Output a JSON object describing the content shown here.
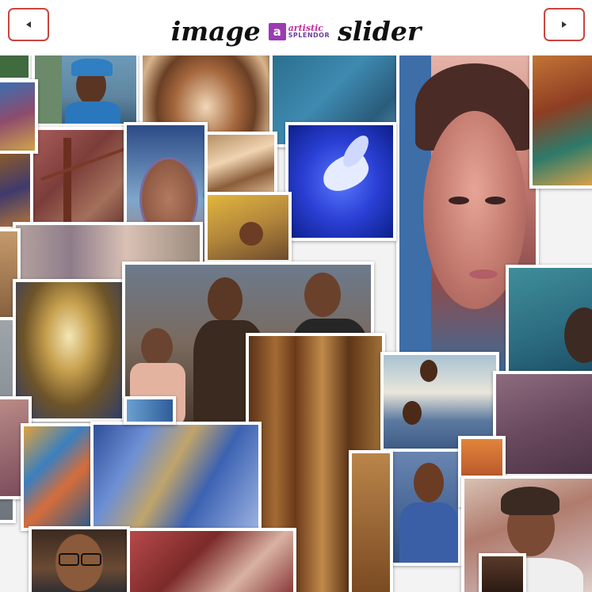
{
  "header": {
    "title_left": "image",
    "title_right": "slider",
    "logo_mark": "a",
    "logo_word_top": "artistic",
    "logo_word_bottom": "SPLENDOR",
    "prev_icon": "left-triangle-icon",
    "next_icon": "right-triangle-icon",
    "button_border_color": "#c8463f"
  },
  "gallery": {
    "tiles": [
      {
        "name": "painting-green-corner"
      },
      {
        "name": "painting-woman-blue-headwrap"
      },
      {
        "name": "painting-swirl-abstract"
      },
      {
        "name": "painting-blue-figure"
      },
      {
        "name": "painting-woman-closeup"
      },
      {
        "name": "painting-tree-abstract"
      },
      {
        "name": "painting-brown-tree"
      },
      {
        "name": "painting-woman-oval"
      },
      {
        "name": "painting-wood-swirl"
      },
      {
        "name": "painting-white-dove"
      },
      {
        "name": "painting-mask-yellow"
      },
      {
        "name": "painting-family-portrait"
      },
      {
        "name": "painting-wooden-carving"
      },
      {
        "name": "painting-couple-landscape"
      },
      {
        "name": "painting-woman-teal"
      },
      {
        "name": "painting-abstract-blue-geometric"
      },
      {
        "name": "painting-man-blue-shirt"
      },
      {
        "name": "painting-old-woman"
      },
      {
        "name": "painting-man-glasses"
      },
      {
        "name": "painting-spiral-figures"
      }
    ]
  }
}
